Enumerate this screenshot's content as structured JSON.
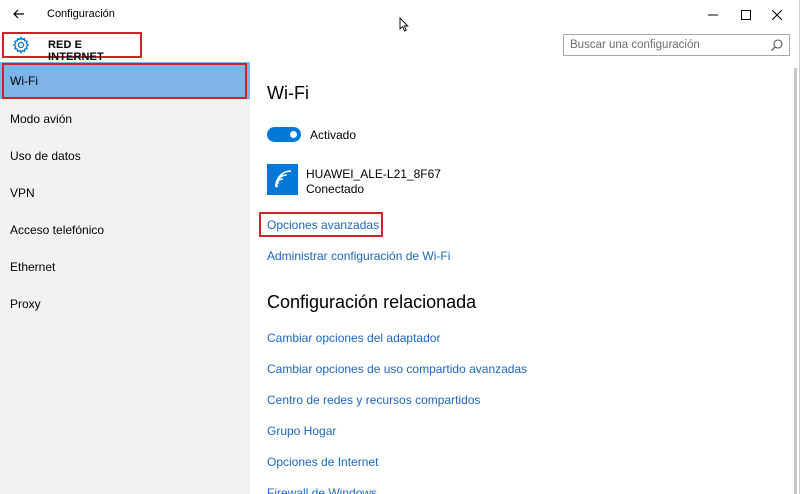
{
  "window": {
    "title": "Configuración"
  },
  "header": {
    "section_title": "RED E INTERNET",
    "search_placeholder": "Buscar una configuración"
  },
  "sidebar": {
    "items": [
      {
        "label": "Wi-Fi",
        "active": true
      },
      {
        "label": "Modo avión"
      },
      {
        "label": "Uso de datos"
      },
      {
        "label": "VPN"
      },
      {
        "label": "Acceso telefónico"
      },
      {
        "label": "Ethernet"
      },
      {
        "label": "Proxy"
      }
    ]
  },
  "main": {
    "heading": "Wi-Fi",
    "toggle_label": "Activado",
    "toggle_on": true,
    "network": {
      "name": "HUAWEI_ALE-L21_8F67",
      "status": "Conectado",
      "icon": "wifi-signal-icon"
    },
    "links": {
      "advanced": "Opciones avanzadas",
      "manage": "Administrar configuración de Wi-Fi"
    },
    "related": {
      "heading": "Configuración relacionada",
      "links": [
        "Cambiar opciones del adaptador",
        "Cambiar opciones de uso compartido avanzadas",
        "Centro de redes y recursos compartidos",
        "Grupo Hogar",
        "Opciones de Internet",
        "Firewall de Windows"
      ]
    }
  },
  "colors": {
    "accent": "#0078d7",
    "link": "#1a66c4",
    "selected_item": "#7eb4ea",
    "highlight_box": "#d0202a",
    "sidebar_bg": "#f2f2f2"
  }
}
